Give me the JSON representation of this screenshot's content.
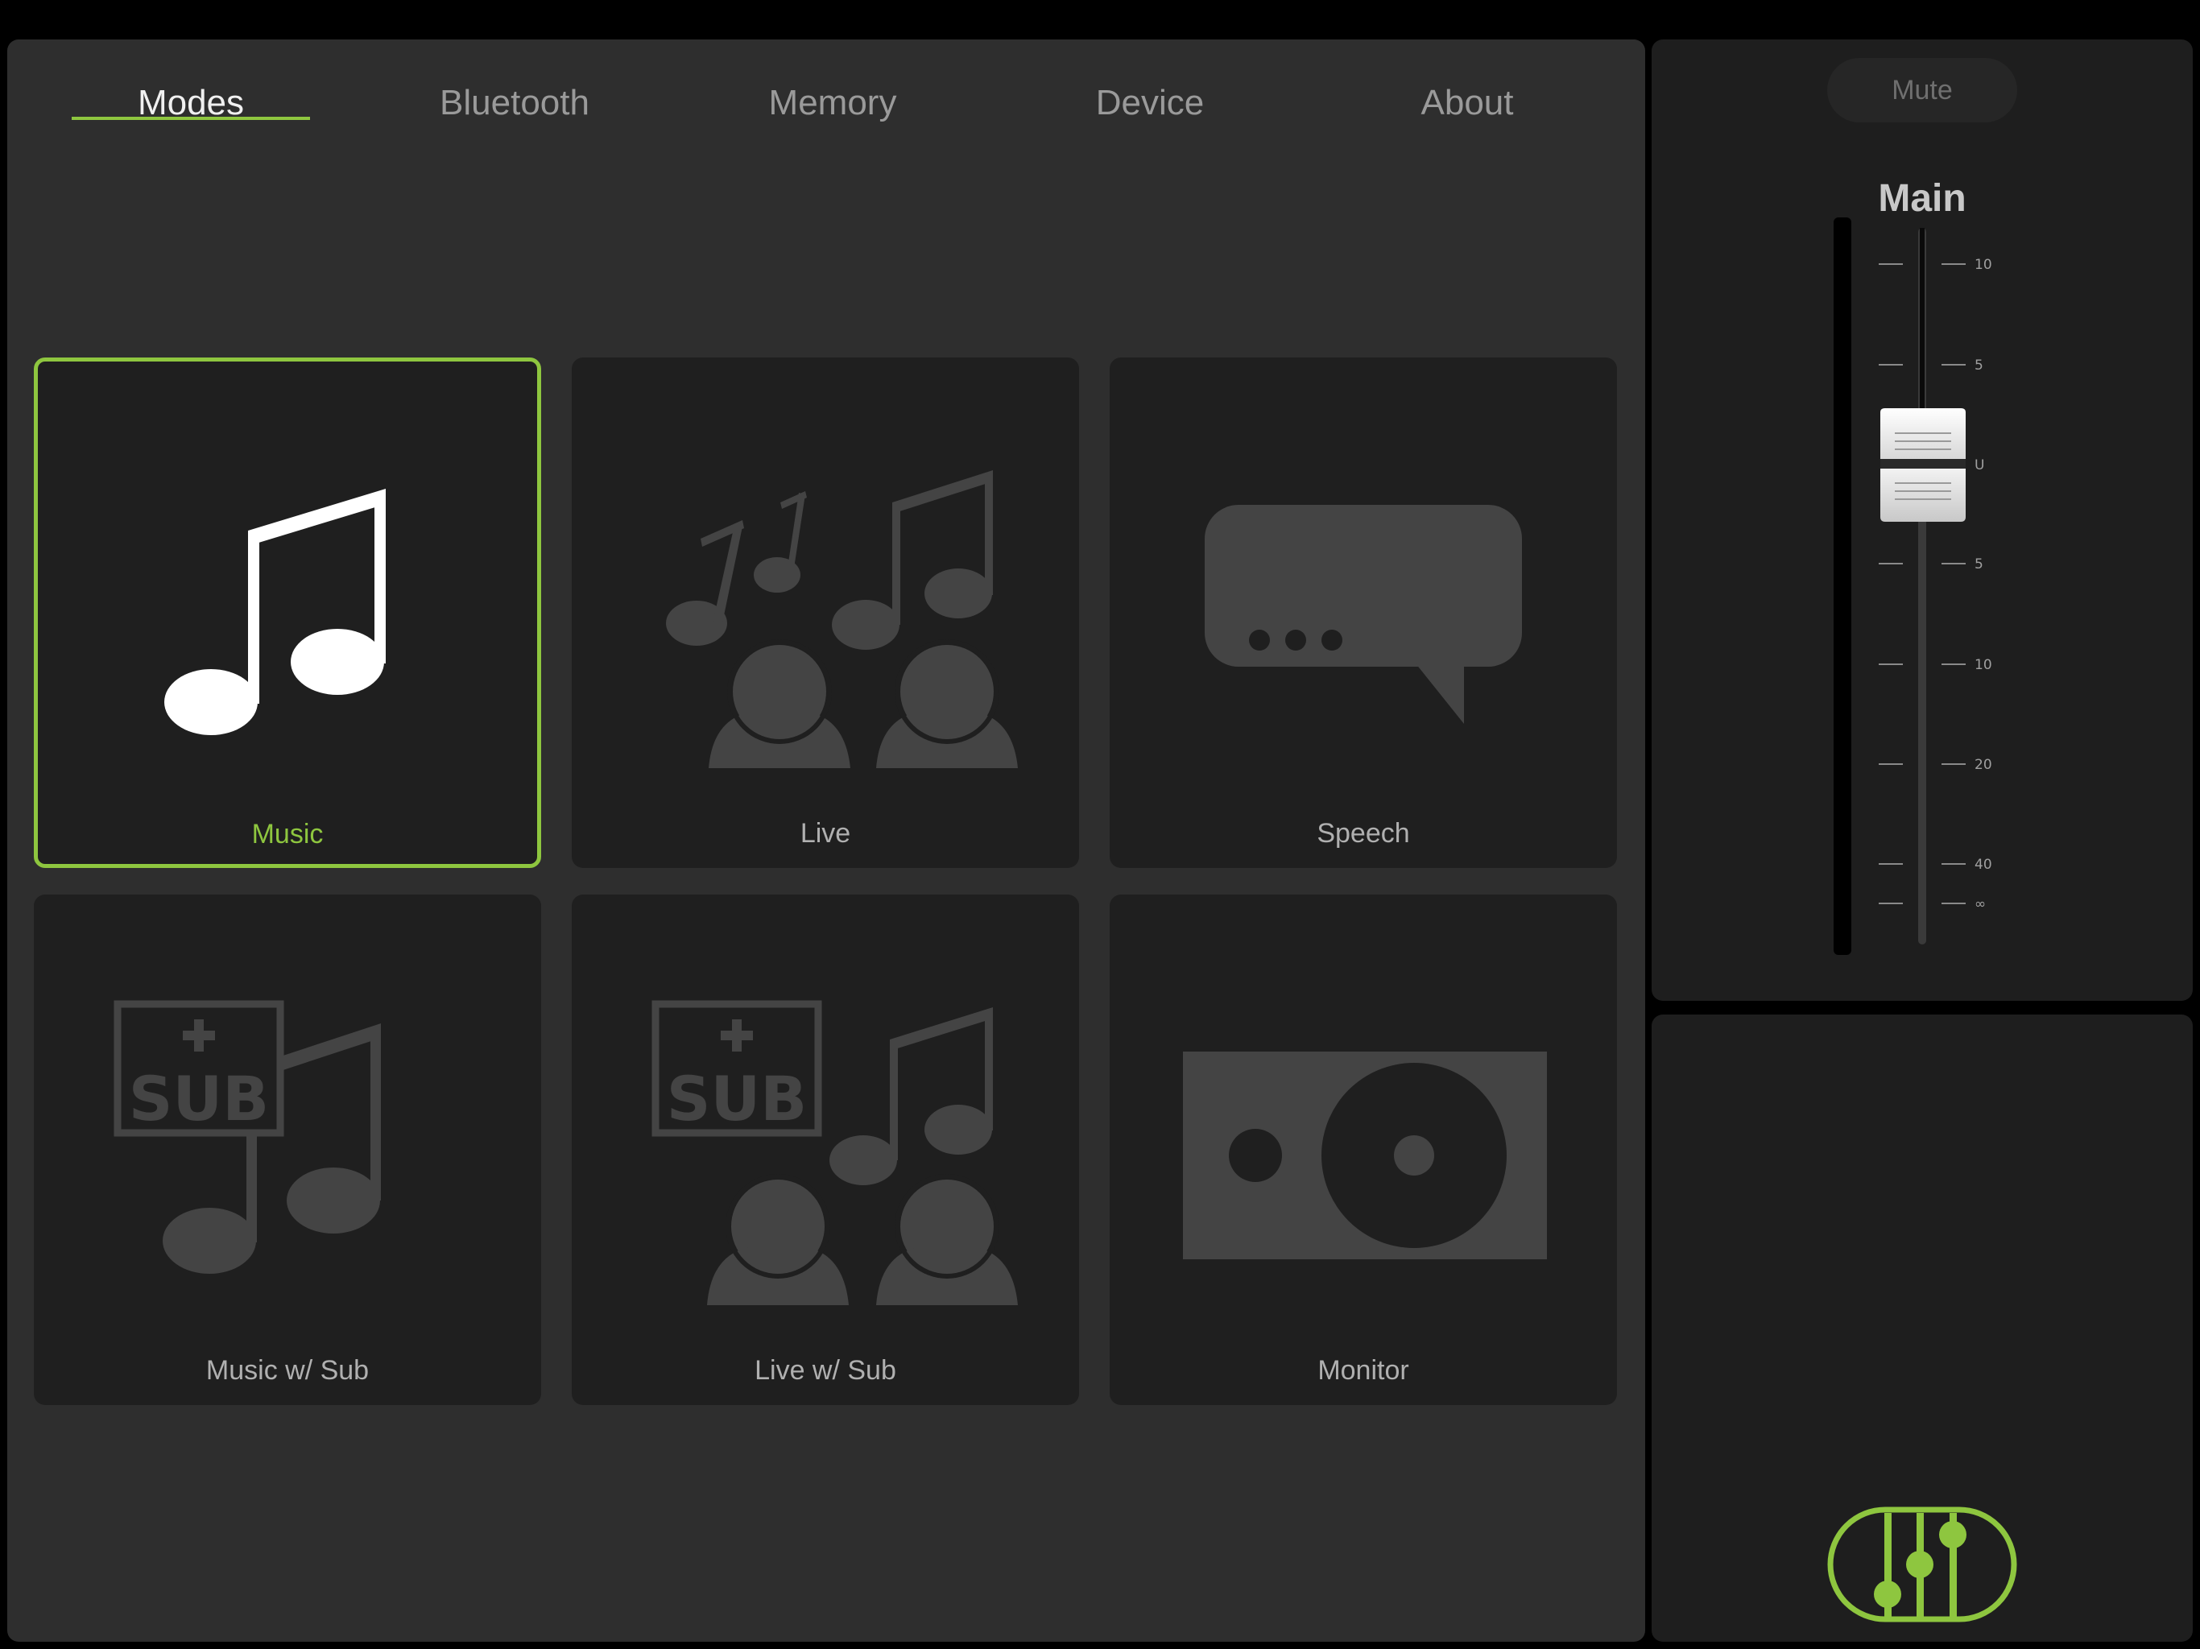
{
  "tabs": [
    {
      "label": "Modes",
      "active": true
    },
    {
      "label": "Bluetooth",
      "active": false
    },
    {
      "label": "Memory",
      "active": false
    },
    {
      "label": "Device",
      "active": false
    },
    {
      "label": "About",
      "active": false
    }
  ],
  "modes": [
    {
      "label": "Music",
      "icon": "music-note-icon",
      "selected": true
    },
    {
      "label": "Live",
      "icon": "live-audience-icon",
      "selected": false
    },
    {
      "label": "Speech",
      "icon": "speech-bubble-icon",
      "selected": false
    },
    {
      "label": "Music w/ Sub",
      "icon": "music-sub-icon",
      "selected": false
    },
    {
      "label": "Live w/ Sub",
      "icon": "live-sub-icon",
      "selected": false
    },
    {
      "label": "Monitor",
      "icon": "monitor-speaker-icon",
      "selected": false
    }
  ],
  "icon_text": {
    "sub": "SUB"
  },
  "channel": {
    "mute_label": "Mute",
    "title": "Main",
    "fader_level": "U",
    "scale_labels": [
      "10",
      "5",
      "U",
      "5",
      "10",
      "20",
      "40",
      "∞"
    ]
  },
  "colors": {
    "accent": "#8ec63f",
    "panel": "#2e2e2e",
    "tile": "#1f1f1f",
    "icon_inactive": "#444444",
    "icon_active": "#ffffff"
  }
}
